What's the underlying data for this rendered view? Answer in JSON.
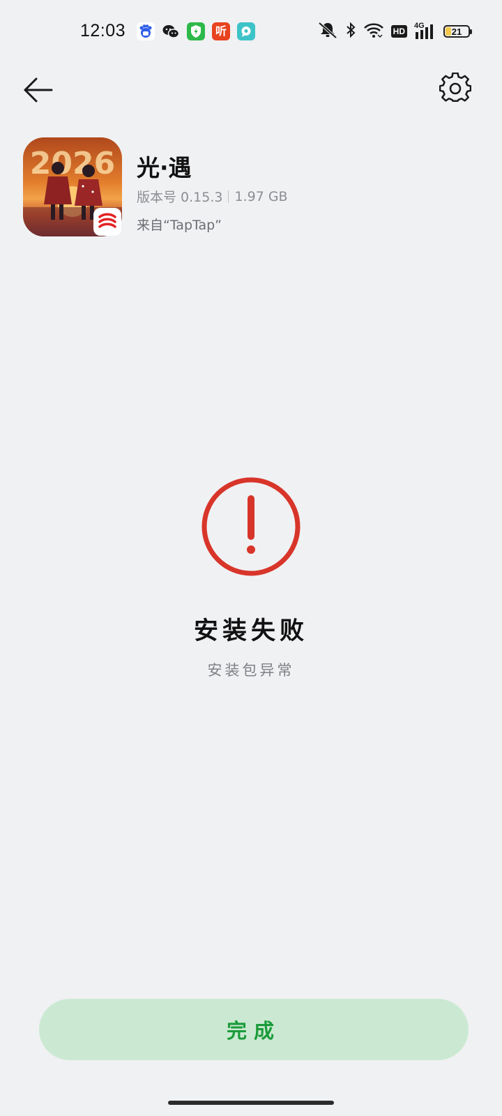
{
  "status_bar": {
    "time": "12:03",
    "notification_icons": [
      "baidu-icon",
      "wechat-icon",
      "security-shield-icon",
      "ting-audio-icon",
      "chat-bubble-icon"
    ],
    "ting_label": "听",
    "network_badge": "HD",
    "network_type": "4G",
    "battery_level": "21"
  },
  "header": {
    "back_icon": "arrow-left-icon",
    "settings_icon": "gear-icon"
  },
  "app": {
    "name": "光·遇",
    "version_label": "版本号 0.15.3",
    "size": "1.97 GB",
    "source": "来自“TapTap”",
    "icon_art_text": "2026"
  },
  "result": {
    "icon": "error-exclamation-icon",
    "title": "安装失败",
    "subtitle": "安装包异常"
  },
  "actions": {
    "done_label": "完成"
  },
  "colors": {
    "background": "#f0f1f3",
    "error_red": "#d8352a",
    "button_bg": "#cbe9d2",
    "button_text": "#1b9b3a"
  }
}
